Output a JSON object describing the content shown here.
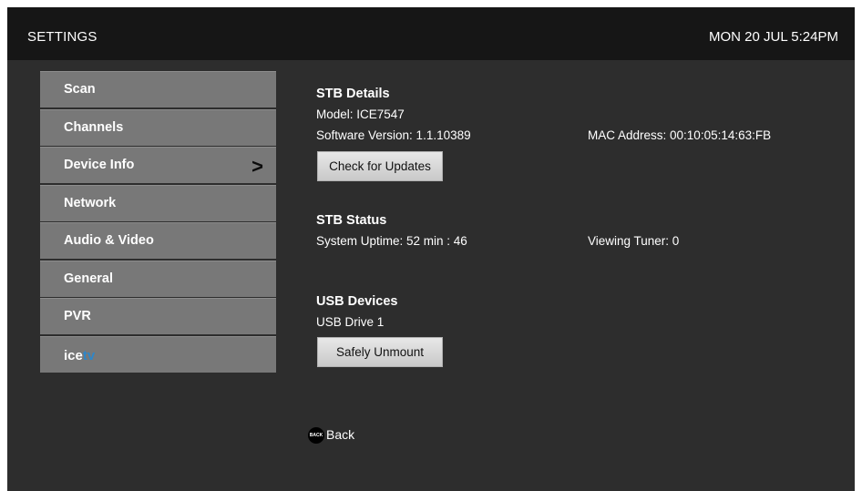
{
  "header": {
    "title": "SETTINGS",
    "clock": "MON 20 JUL 5:24PM"
  },
  "menu": {
    "items": [
      {
        "label": "Scan"
      },
      {
        "label": "Channels"
      },
      {
        "label": "Device Info",
        "selected": true
      },
      {
        "label": "Network"
      },
      {
        "label": "Audio & Video"
      },
      {
        "label": "General"
      },
      {
        "label": "PVR"
      }
    ],
    "logo": {
      "part1": "ice",
      "part2": "tv"
    }
  },
  "stb_details": {
    "title": "STB Details",
    "model": "Model: ICE7547",
    "software_version": "Software Version: 1.1.10389",
    "mac_address": "MAC Address: 00:10:05:14:63:FB",
    "check_updates_label": "Check for Updates"
  },
  "stb_status": {
    "title": "STB Status",
    "uptime": "System Uptime: 52 min : 46",
    "viewing_tuner": "Viewing Tuner: 0"
  },
  "usb_devices": {
    "title": "USB Devices",
    "device": "USB Drive 1",
    "unmount_label": "Safely Unmount"
  },
  "footer": {
    "back_badge": "BACK",
    "back_label": "Back"
  },
  "colors": {
    "background": "#2d2d2d",
    "header": "#161616",
    "menu_item": "#787878",
    "logo_accent": "#2e86c8"
  }
}
